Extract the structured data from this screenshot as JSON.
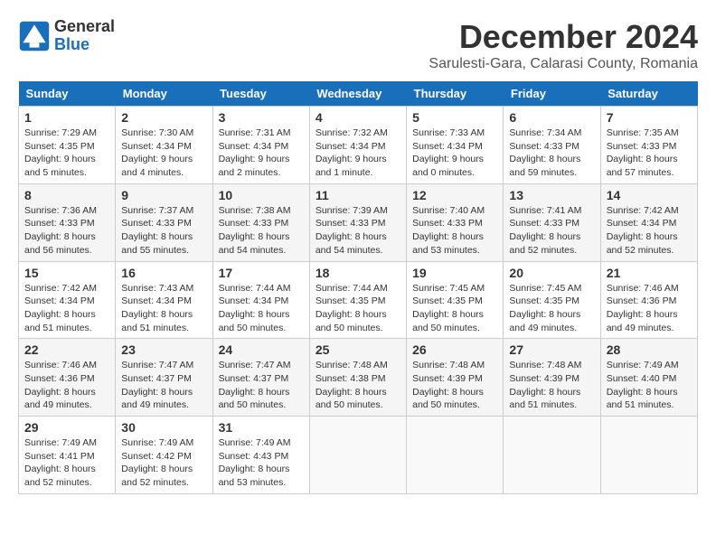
{
  "logo": {
    "line1": "General",
    "line2": "Blue"
  },
  "title": "December 2024",
  "subtitle": "Sarulesti-Gara, Calarasi County, Romania",
  "weekdays": [
    "Sunday",
    "Monday",
    "Tuesday",
    "Wednesday",
    "Thursday",
    "Friday",
    "Saturday"
  ],
  "weeks": [
    [
      {
        "day": "1",
        "info": "Sunrise: 7:29 AM\nSunset: 4:35 PM\nDaylight: 9 hours\nand 5 minutes."
      },
      {
        "day": "2",
        "info": "Sunrise: 7:30 AM\nSunset: 4:34 PM\nDaylight: 9 hours\nand 4 minutes."
      },
      {
        "day": "3",
        "info": "Sunrise: 7:31 AM\nSunset: 4:34 PM\nDaylight: 9 hours\nand 2 minutes."
      },
      {
        "day": "4",
        "info": "Sunrise: 7:32 AM\nSunset: 4:34 PM\nDaylight: 9 hours\nand 1 minute."
      },
      {
        "day": "5",
        "info": "Sunrise: 7:33 AM\nSunset: 4:34 PM\nDaylight: 9 hours\nand 0 minutes."
      },
      {
        "day": "6",
        "info": "Sunrise: 7:34 AM\nSunset: 4:33 PM\nDaylight: 8 hours\nand 59 minutes."
      },
      {
        "day": "7",
        "info": "Sunrise: 7:35 AM\nSunset: 4:33 PM\nDaylight: 8 hours\nand 57 minutes."
      }
    ],
    [
      {
        "day": "8",
        "info": "Sunrise: 7:36 AM\nSunset: 4:33 PM\nDaylight: 8 hours\nand 56 minutes."
      },
      {
        "day": "9",
        "info": "Sunrise: 7:37 AM\nSunset: 4:33 PM\nDaylight: 8 hours\nand 55 minutes."
      },
      {
        "day": "10",
        "info": "Sunrise: 7:38 AM\nSunset: 4:33 PM\nDaylight: 8 hours\nand 54 minutes."
      },
      {
        "day": "11",
        "info": "Sunrise: 7:39 AM\nSunset: 4:33 PM\nDaylight: 8 hours\nand 54 minutes."
      },
      {
        "day": "12",
        "info": "Sunrise: 7:40 AM\nSunset: 4:33 PM\nDaylight: 8 hours\nand 53 minutes."
      },
      {
        "day": "13",
        "info": "Sunrise: 7:41 AM\nSunset: 4:33 PM\nDaylight: 8 hours\nand 52 minutes."
      },
      {
        "day": "14",
        "info": "Sunrise: 7:42 AM\nSunset: 4:34 PM\nDaylight: 8 hours\nand 52 minutes."
      }
    ],
    [
      {
        "day": "15",
        "info": "Sunrise: 7:42 AM\nSunset: 4:34 PM\nDaylight: 8 hours\nand 51 minutes."
      },
      {
        "day": "16",
        "info": "Sunrise: 7:43 AM\nSunset: 4:34 PM\nDaylight: 8 hours\nand 51 minutes."
      },
      {
        "day": "17",
        "info": "Sunrise: 7:44 AM\nSunset: 4:34 PM\nDaylight: 8 hours\nand 50 minutes."
      },
      {
        "day": "18",
        "info": "Sunrise: 7:44 AM\nSunset: 4:35 PM\nDaylight: 8 hours\nand 50 minutes."
      },
      {
        "day": "19",
        "info": "Sunrise: 7:45 AM\nSunset: 4:35 PM\nDaylight: 8 hours\nand 50 minutes."
      },
      {
        "day": "20",
        "info": "Sunrise: 7:45 AM\nSunset: 4:35 PM\nDaylight: 8 hours\nand 49 minutes."
      },
      {
        "day": "21",
        "info": "Sunrise: 7:46 AM\nSunset: 4:36 PM\nDaylight: 8 hours\nand 49 minutes."
      }
    ],
    [
      {
        "day": "22",
        "info": "Sunrise: 7:46 AM\nSunset: 4:36 PM\nDaylight: 8 hours\nand 49 minutes."
      },
      {
        "day": "23",
        "info": "Sunrise: 7:47 AM\nSunset: 4:37 PM\nDaylight: 8 hours\nand 49 minutes."
      },
      {
        "day": "24",
        "info": "Sunrise: 7:47 AM\nSunset: 4:37 PM\nDaylight: 8 hours\nand 50 minutes."
      },
      {
        "day": "25",
        "info": "Sunrise: 7:48 AM\nSunset: 4:38 PM\nDaylight: 8 hours\nand 50 minutes."
      },
      {
        "day": "26",
        "info": "Sunrise: 7:48 AM\nSunset: 4:39 PM\nDaylight: 8 hours\nand 50 minutes."
      },
      {
        "day": "27",
        "info": "Sunrise: 7:48 AM\nSunset: 4:39 PM\nDaylight: 8 hours\nand 51 minutes."
      },
      {
        "day": "28",
        "info": "Sunrise: 7:49 AM\nSunset: 4:40 PM\nDaylight: 8 hours\nand 51 minutes."
      }
    ],
    [
      {
        "day": "29",
        "info": "Sunrise: 7:49 AM\nSunset: 4:41 PM\nDaylight: 8 hours\nand 52 minutes."
      },
      {
        "day": "30",
        "info": "Sunrise: 7:49 AM\nSunset: 4:42 PM\nDaylight: 8 hours\nand 52 minutes."
      },
      {
        "day": "31",
        "info": "Sunrise: 7:49 AM\nSunset: 4:43 PM\nDaylight: 8 hours\nand 53 minutes."
      },
      {
        "day": "",
        "info": ""
      },
      {
        "day": "",
        "info": ""
      },
      {
        "day": "",
        "info": ""
      },
      {
        "day": "",
        "info": ""
      }
    ]
  ]
}
